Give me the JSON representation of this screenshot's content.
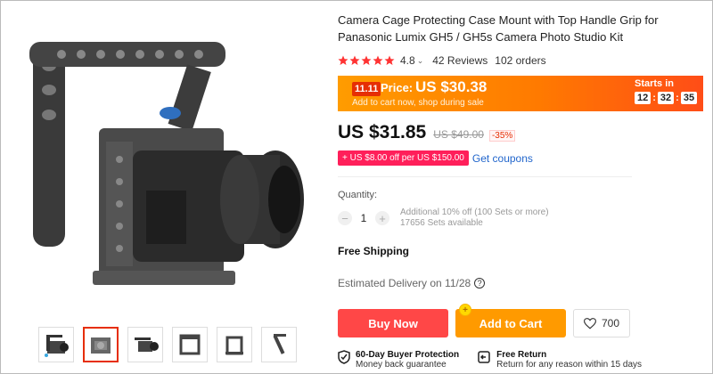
{
  "product": {
    "title": "Camera Cage Protecting Case Mount with Top Handle Grip for Panasonic Lumix GH5 / GH5s Camera Photo Studio Kit",
    "rating": "4.8",
    "reviews": "42 Reviews",
    "orders": "102 orders"
  },
  "promo": {
    "badge": "11.11",
    "price_label": "Price:",
    "price": "US $30.38",
    "subtext": "Add to cart now, shop during sale",
    "starts_in": "Starts in",
    "timer": {
      "h": "12",
      "m": "32",
      "s": "35"
    }
  },
  "price": {
    "current": "US $31.85",
    "original": "US $49.00",
    "discount": "-35%"
  },
  "coupon": {
    "tag": "+ US $8.00 off per US $150.00",
    "link": "Get coupons"
  },
  "quantity": {
    "label": "Quantity:",
    "minus": "−",
    "value": "1",
    "plus": "+",
    "note_line1": "Additional 10% off (100 Sets or more)",
    "note_line2": "17656 Sets available"
  },
  "shipping": {
    "free": "Free Shipping",
    "delivery": "Estimated Delivery on 11/28",
    "help": "?"
  },
  "actions": {
    "buy_now": "Buy Now",
    "add_to_cart": "Add to Cart",
    "wishlist_count": "700"
  },
  "guarantees": [
    {
      "title": "60-Day Buyer Protection",
      "sub": "Money back guarantee",
      "icon": "shield-check-icon"
    },
    {
      "title": "Free Return",
      "sub": "Return for any reason within 15 days",
      "icon": "return-icon"
    }
  ],
  "colors": {
    "accent_red": "#ff4747",
    "cart_orange": "#ff9a00",
    "badge_red": "#e62e04",
    "link_blue": "#2266cc"
  },
  "thumbnails": [
    {
      "icon": "camera-cage-thumb-1"
    },
    {
      "icon": "camera-cage-thumb-2",
      "selected": true
    },
    {
      "icon": "camera-cage-thumb-3"
    },
    {
      "icon": "camera-cage-thumb-4"
    },
    {
      "icon": "camera-cage-thumb-5"
    },
    {
      "icon": "camera-cage-thumb-6"
    }
  ]
}
